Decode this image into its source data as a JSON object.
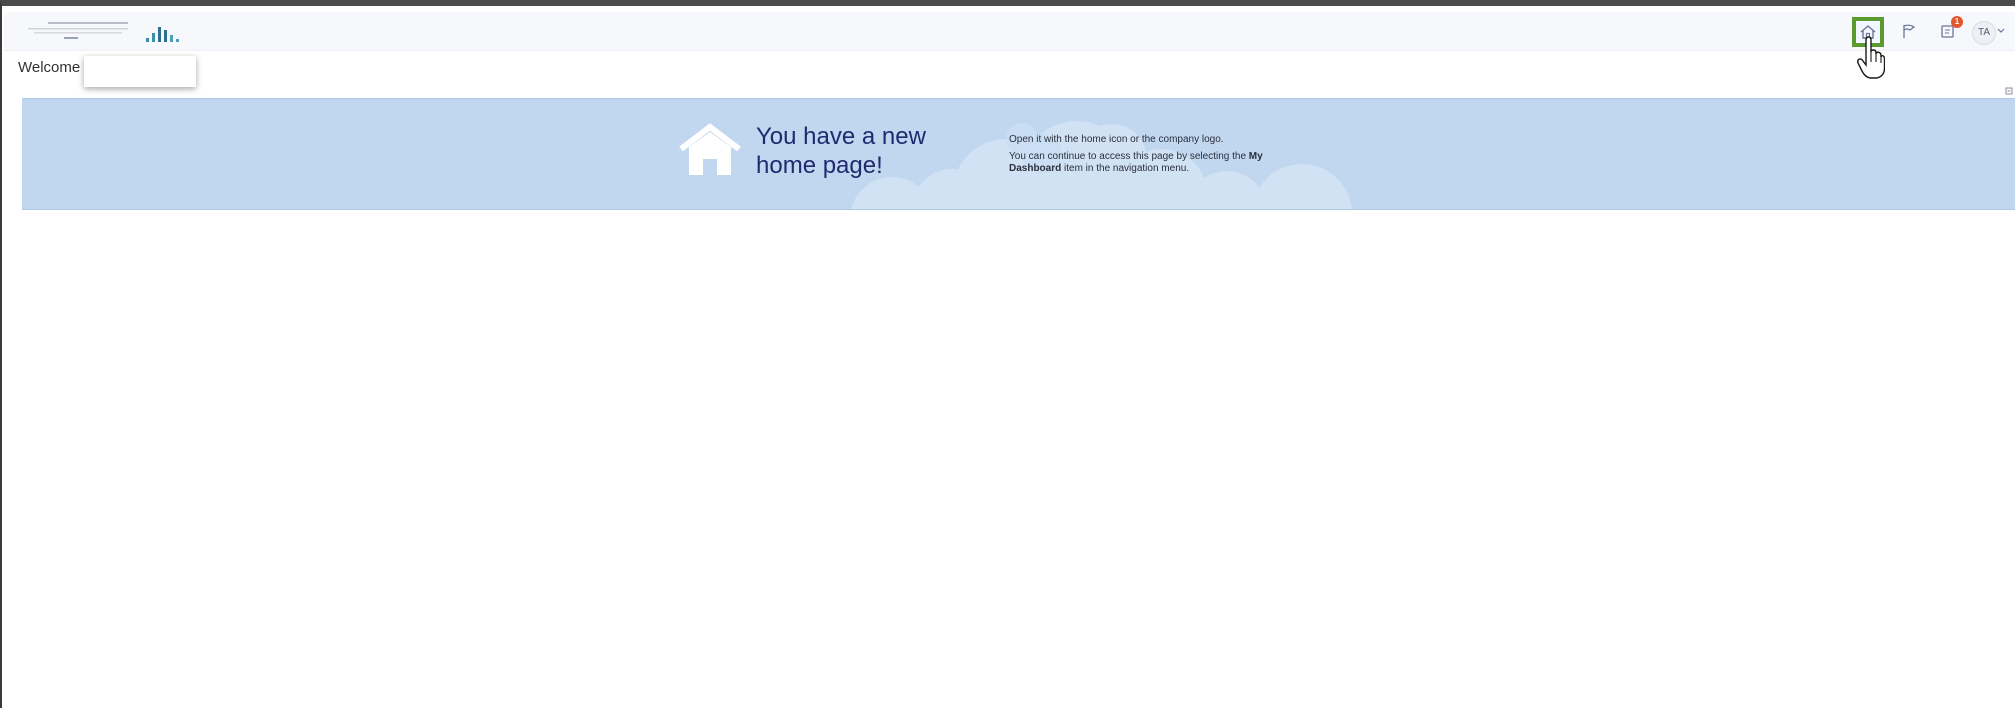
{
  "header": {
    "logo": {
      "alt": "company-logo",
      "bars_color": "#3a8fa8"
    },
    "actions": {
      "home_icon": "home-icon",
      "flag_icon": "flag-icon",
      "notifications_icon": "notifications-icon",
      "notifications_badge": "1",
      "avatar_initials": "TA",
      "caret_icon": "chevron-down-icon",
      "active_highlight_color": "#5a9a2e"
    }
  },
  "welcome": {
    "label": "Welcome"
  },
  "banner": {
    "icon": "house-icon",
    "title_line1": "You have a new",
    "title_line2": "home page!",
    "line1": "Open it with the home icon or the company logo.",
    "line2_prefix": "You can continue to access this page by selecting the",
    "line2_bold1": "My",
    "line2_bold2": "Dashboard",
    "line2_suffix": "item in the navigation menu.",
    "background_color": "#c1d7ef",
    "title_color": "#1f2a6f"
  }
}
